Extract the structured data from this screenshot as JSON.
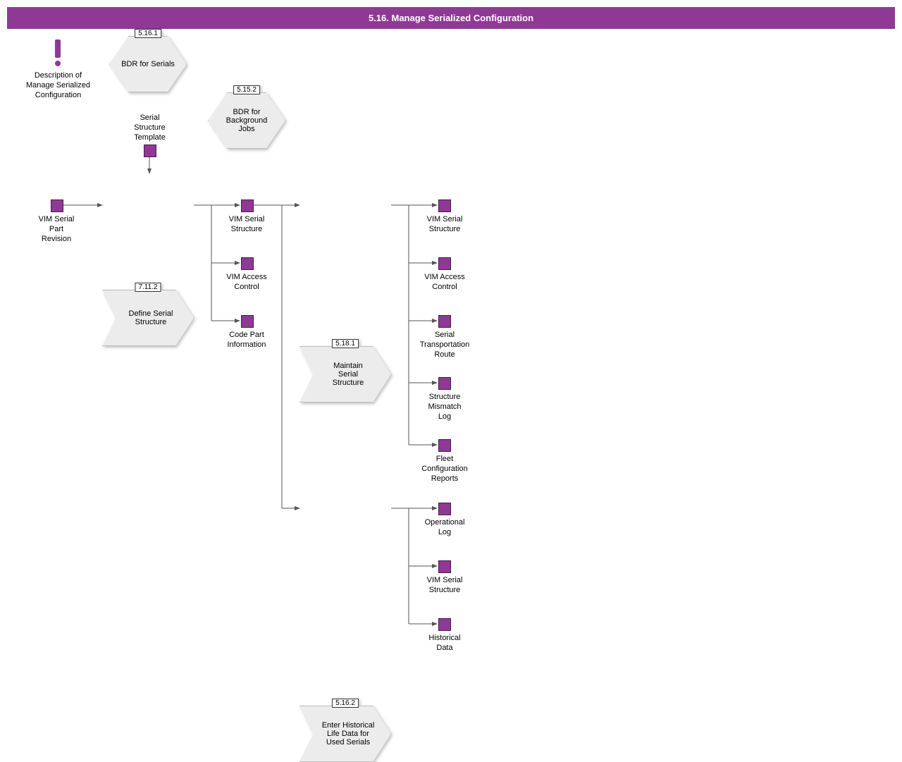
{
  "header_title": "5.16. Manage Serialized Configuration",
  "note": {
    "label": "Description of\nManage Serialized\nConfiguration"
  },
  "bdr1": {
    "tag": "5.16.1",
    "label": "BDR for Serials"
  },
  "bdr2": {
    "tag": "5.15.2",
    "label": "BDR for\nBackground\nJobs"
  },
  "data_top": {
    "label": "Serial\nStructure\nTemplate"
  },
  "data_in": {
    "label": "VIM Serial\nPart\nRevision"
  },
  "proc_define": {
    "tag": "7.11.2",
    "label": "Define Serial\nStructure"
  },
  "proc_maintain": {
    "tag": "5.18.1",
    "label": "Maintain\nSerial\nStructure"
  },
  "proc_hist": {
    "tag": "5.16.2",
    "label": "Enter Historical\nLife Data for\nUsed Serials"
  },
  "mid_outputs": [
    {
      "label": "VIM Serial\nStructure"
    },
    {
      "label": "VIM Access\nControl"
    },
    {
      "label": "Code Part\nInformation"
    }
  ],
  "maintain_outputs": [
    {
      "label": "VIM Serial\nStructure"
    },
    {
      "label": "VIM Access\nControl"
    },
    {
      "label": "Serial\nTransportation\nRoute"
    },
    {
      "label": "Structure\nMismatch\nLog"
    },
    {
      "label": "Fleet\nConfiguration\nReports"
    }
  ],
  "hist_outputs": [
    {
      "label": "Operational\nLog"
    },
    {
      "label": "VIM Serial\nStructure"
    },
    {
      "label": "Historical\nData"
    }
  ]
}
